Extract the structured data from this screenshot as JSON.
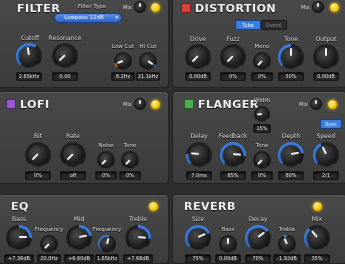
{
  "colors": {
    "accent": "#3b7de0",
    "led": "#f2c200",
    "lofi_icon": "#9b59d0",
    "flanger_icon": "#4caf50",
    "distortion_icon": "#d94040",
    "knob_arc_orange": "#f08a24"
  },
  "filter": {
    "title": "FILTER",
    "mix_label": "Mix",
    "type_label": "Filter Type",
    "type_value": "Lowpass 12dB",
    "cutoff_label": "Cutoff",
    "cutoff_value": "2.65kHz",
    "resonance_label": "Resonance",
    "resonance_value": "0.00",
    "lowcut_label": "Low Cut",
    "lowcut_value": "8.2Hz",
    "hicut_label": "Hi Cut",
    "hicut_value": "21.1kHz"
  },
  "distortion": {
    "title": "DISTORTION",
    "mix_label": "Mix",
    "tube_label": "Tube",
    "overd_label": "Overd.",
    "drive_label": "Drive",
    "drive_value": "0.00dB",
    "fuzz_label": "Fuzz",
    "fuzz_value": "0%",
    "mono_label": "Mono",
    "mono_value": "0%",
    "tone_label": "Tone",
    "tone_value": "50%",
    "output_label": "Output",
    "output_value": "0.00dB"
  },
  "lofi": {
    "title": "LOFI",
    "mix_label": "Mix",
    "bit_label": "Bit",
    "bit_value": "0%",
    "rate_label": "Rate",
    "rate_value": "off",
    "noise_label": "Noise",
    "noise_value": "0%",
    "tone_label": "Tone",
    "tone_value": "0%"
  },
  "flanger": {
    "title": "FLANGER",
    "mix_label": "Mix",
    "width_label": "Width",
    "width_value": "15%",
    "sync_label": "Sync",
    "delay_label": "Delay",
    "delay_value": "7.0ms",
    "feedback_label": "Feedback",
    "feedback_value": "85%",
    "tone_label": "Tone",
    "tone_value": "0%",
    "depth_label": "Depth",
    "depth_value": "80%",
    "speed_label": "Speed",
    "speed_value": "2/1"
  },
  "eq": {
    "title": "EQ",
    "bass_label": "Bass",
    "bass_value": "+7.36dB",
    "freq1_label": "Frequency",
    "freq1_value": "20.0Hz",
    "mid_label": "Mid",
    "mid_value": "+6.60dB",
    "freq2_label": "Frequency",
    "freq2_value": "1.65kHz",
    "treble_label": "Treble",
    "treble_value": "+7.68dB"
  },
  "reverb": {
    "title": "REVERB",
    "size_label": "Size",
    "size_value": "75%",
    "bass_label": "Bass",
    "bass_value": "0.00dB",
    "decay_label": "Decay",
    "decay_value": "70%",
    "treble_label": "Treble",
    "treble_value": "-1.92dB",
    "mix_label": "Mix",
    "mix_value": "35%"
  }
}
